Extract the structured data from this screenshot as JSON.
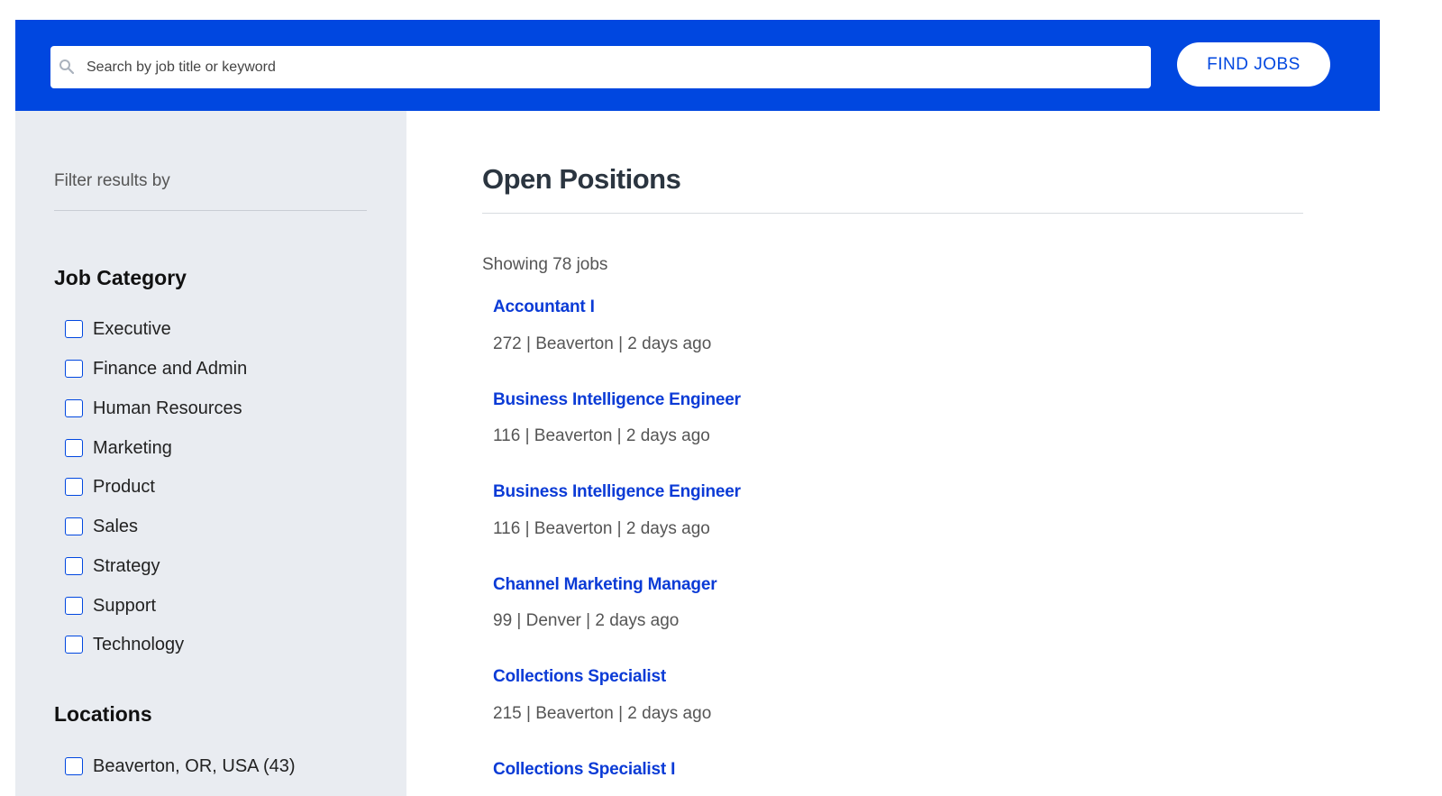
{
  "search": {
    "placeholder": "Search by job title or keyword",
    "button_label": "FIND JOBS"
  },
  "sidebar": {
    "filter_title": "Filter results by",
    "job_category": {
      "heading": "Job Category",
      "items": [
        "Executive",
        "Finance and Admin",
        "Human Resources",
        "Marketing",
        "Product",
        "Sales",
        "Strategy",
        "Support",
        "Technology"
      ]
    },
    "locations": {
      "heading": "Locations",
      "items": [
        "Beaverton, OR, USA (43)"
      ]
    }
  },
  "main": {
    "title": "Open Positions",
    "showing": "Showing 78 jobs",
    "jobs": [
      {
        "title": "Accountant I",
        "meta": "272 | Beaverton | 2 days ago"
      },
      {
        "title": "Business Intelligence Engineer",
        "meta": "116 | Beaverton | 2 days ago"
      },
      {
        "title": "Business Intelligence Engineer",
        "meta": "116 | Beaverton | 2 days ago"
      },
      {
        "title": "Channel Marketing Manager",
        "meta": "99 | Denver | 2 days ago"
      },
      {
        "title": "Collections Specialist",
        "meta": "215 | Beaverton | 2 days ago"
      },
      {
        "title": "Collections Specialist I",
        "meta": ""
      }
    ]
  },
  "colors": {
    "brand": "#0047e0",
    "link": "#0b3bd6",
    "sidebar_bg": "#e9ecf1"
  }
}
